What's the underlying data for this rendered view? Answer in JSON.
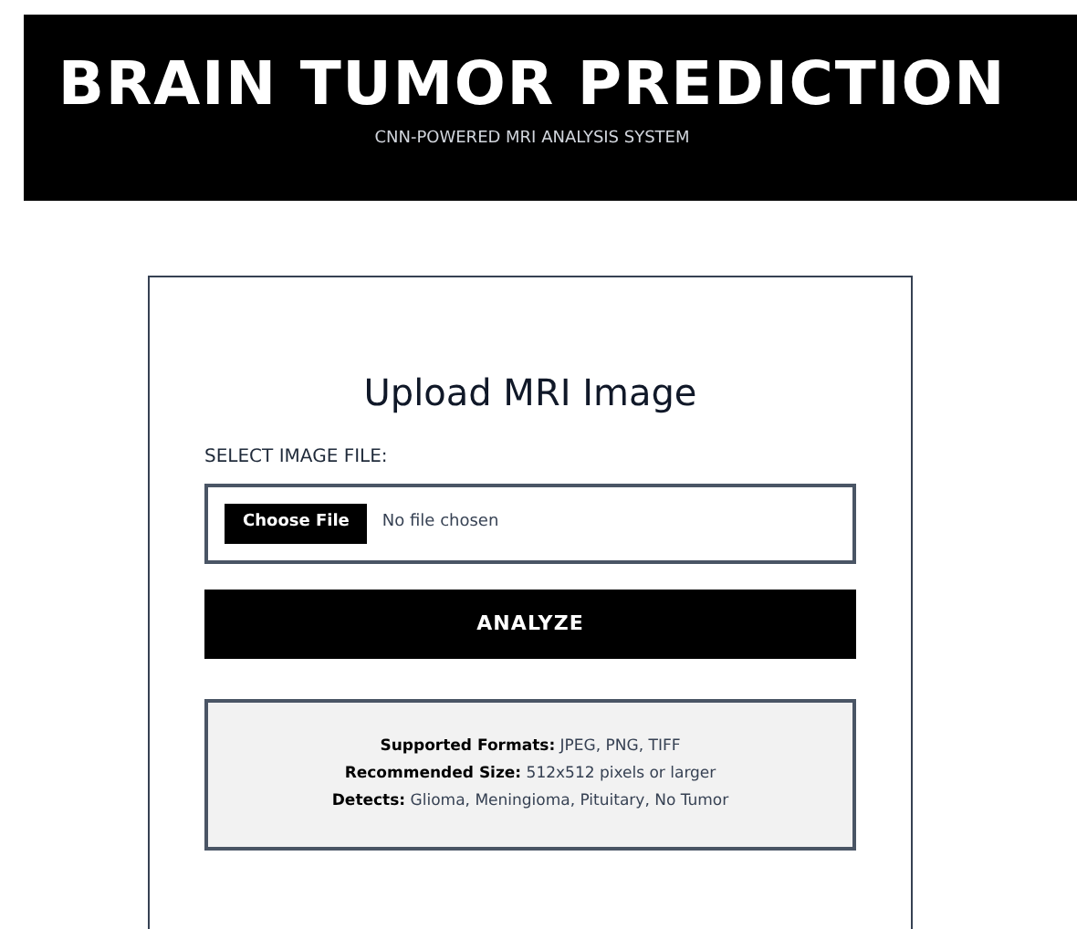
{
  "header": {
    "title": "BRAIN TUMOR PREDICTION",
    "subtitle": "CNN-POWERED MRI ANALYSIS SYSTEM"
  },
  "upload_card": {
    "title": "Upload MRI Image",
    "field_label": "SELECT IMAGE FILE:",
    "file_input": {
      "button": "Choose File",
      "value": "No file chosen"
    },
    "analyze_button": "ANALYZE",
    "info_lines": [
      "**Supported Formats:** JPEG, PNG, TIFF",
      "**Recommended Size:** 512x512 pixels or larger",
      "**Detects:** Glioma, Meningioma, Pituitary, No Tumor"
    ]
  }
}
